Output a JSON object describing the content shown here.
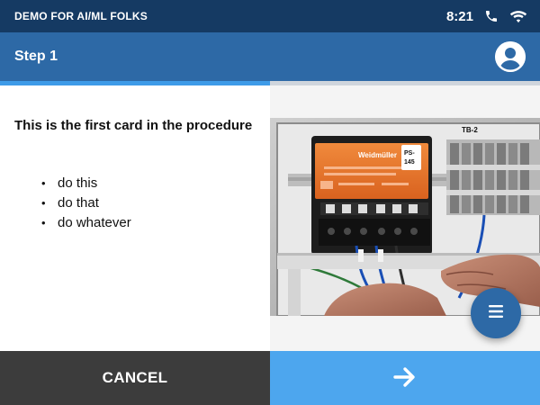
{
  "status_bar": {
    "title": "DEMO FOR AI/ML FOLKS",
    "time": "8:21",
    "icons": [
      "phone-icon",
      "wifi-icon"
    ]
  },
  "app_bar": {
    "title": "Step 1",
    "avatar_icon": "account-circle-icon"
  },
  "progress": {
    "fraction": 0.5
  },
  "card": {
    "heading": "This is the first card in the procedure",
    "bullets": [
      "do this",
      "do that",
      "do whatever"
    ]
  },
  "photo": {
    "labels": {
      "terminal_block": "TB-2",
      "tag_line1": "PS-",
      "tag_line2": "145",
      "brand": "Weidmüller"
    }
  },
  "fab": {
    "icon": "menu-icon"
  },
  "footer": {
    "cancel_label": "CANCEL",
    "next_icon": "arrow-right-icon"
  },
  "colors": {
    "status_bar": "#153a63",
    "app_bar": "#2d69a6",
    "progress_fill": "#3e9be8",
    "cancel_bg": "#3c3c3c",
    "next_bg": "#4da6ee",
    "device_orange": "#e8742c"
  }
}
